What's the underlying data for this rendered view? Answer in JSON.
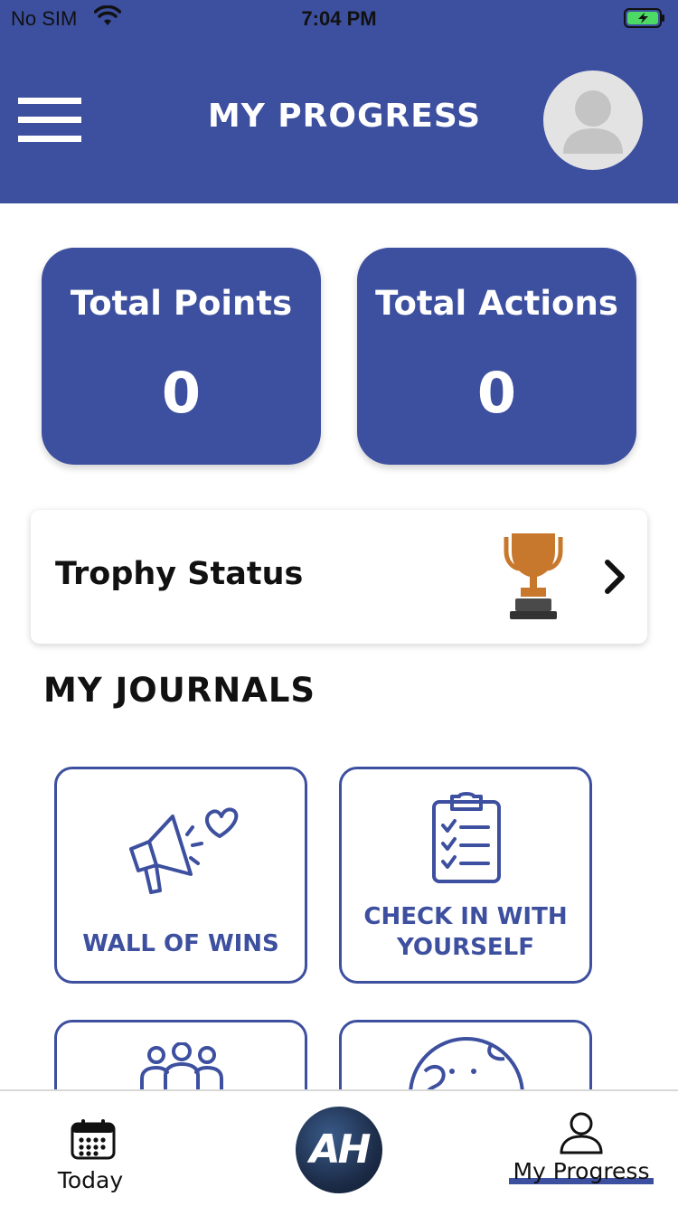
{
  "status_bar": {
    "carrier": "No SIM",
    "time": "7:04 PM"
  },
  "header": {
    "title": "MY PROGRESS",
    "menu_icon": "hamburger-menu-icon",
    "avatar_icon": "user-avatar-placeholder-icon"
  },
  "stats": {
    "points": {
      "label": "Total Points",
      "value": "0"
    },
    "actions": {
      "label": "Total Actions",
      "value": "0"
    }
  },
  "trophy": {
    "label": "Trophy Status",
    "icon": "bronze-trophy-icon"
  },
  "journals": {
    "title": "MY JOURNALS",
    "tiles": [
      {
        "label": "WALL OF WINS",
        "icon": "megaphone-heart-icon"
      },
      {
        "label_line1": "CHECK IN WITH",
        "label_line2": "YOURSELF",
        "icon": "clipboard-checklist-icon"
      },
      {
        "label": "",
        "icon": "community-people-icon"
      },
      {
        "label": "",
        "icon": "globe-icon"
      }
    ]
  },
  "tab_bar": {
    "today": "Today",
    "home_logo": "AH",
    "progress": "My Progress"
  },
  "colors": {
    "brand": "#3d4f9f",
    "trophy": "#c8782d",
    "battery": "#4cd964"
  }
}
